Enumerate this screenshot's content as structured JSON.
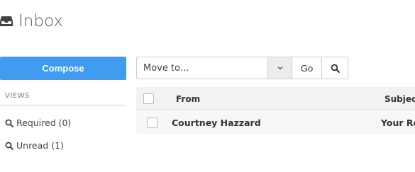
{
  "header": {
    "title": "Inbox",
    "icon": "inbox-icon"
  },
  "sidebar": {
    "compose_label": "Compose",
    "compose_color": "#3f9cf0",
    "views_heading": "VIEWS",
    "views": [
      {
        "label": "Required (0)",
        "icon": "search-icon"
      },
      {
        "label": "Unread (1)",
        "icon": "search-icon"
      }
    ]
  },
  "toolbar": {
    "move_to_label": "Move to...",
    "go_label": "Go",
    "search_icon": "search-icon"
  },
  "table": {
    "columns": [
      "From",
      "Subject"
    ],
    "rows": [
      {
        "from": "Courtney Hazzard",
        "subject": "Your Re"
      }
    ]
  }
}
